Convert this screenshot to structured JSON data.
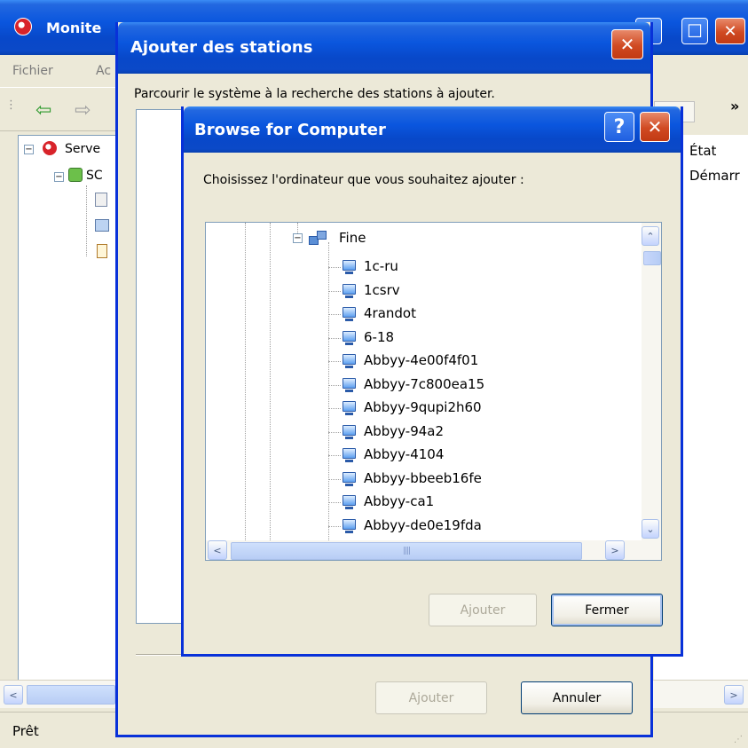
{
  "main_window": {
    "title": "Monite",
    "menu": [
      "Fichier",
      "Ac"
    ],
    "tree": [
      {
        "label": "Serve"
      },
      {
        "label": "SC"
      }
    ],
    "right_overflow": "»",
    "column_header": "État",
    "cell_value": "Démarr",
    "status": "Prêt"
  },
  "stations_dialog": {
    "title": "Ajouter des stations",
    "instruction": "Parcourir le système à la recherche des stations à ajouter.",
    "buttons": {
      "add": "Ajouter",
      "cancel": "Annuler"
    }
  },
  "browse_dialog": {
    "title": "Browse for Computer",
    "prompt": "Choisissez l'ordinateur que vous souhaitez ajouter :",
    "help": "?",
    "group": "Fine",
    "computers": [
      "1c-ru",
      "1csrv",
      "4randot",
      "6-18",
      "Abbyy-4e00f4f01",
      "Abbyy-7c800ea15",
      "Abbyy-9qupi2h60",
      "Abbyy-94a2",
      "Abbyy-4104",
      "Abbyy-bbeeb16fe",
      "Abbyy-ca1",
      "Abbyy-de0e19fda"
    ],
    "buttons": {
      "add": "Ajouter",
      "close": "Fermer"
    }
  },
  "icons": {
    "close": "✕",
    "maximize": "☐",
    "minimize": "_",
    "back": "⇦",
    "forward": "⇨"
  },
  "colors": {
    "titlebar_blue": "#0a56de",
    "close_red": "#d04a22",
    "window_bg": "#ece9d8"
  }
}
